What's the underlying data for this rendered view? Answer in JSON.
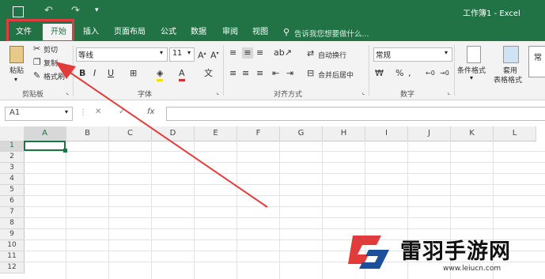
{
  "title_bar": {
    "title": "工作簿1 - Excel"
  },
  "tabs": [
    "文件",
    "开始",
    "插入",
    "页面布局",
    "公式",
    "数据",
    "审阅",
    "视图"
  ],
  "tell_me": "告诉我您想要做什么...",
  "clipboard": {
    "paste": "粘贴",
    "cut": "剪切",
    "copy": "复制",
    "painter": "格式刷",
    "label": "剪贴板"
  },
  "font": {
    "name": "等线",
    "size": "11",
    "label": "字体"
  },
  "alignment": {
    "wrap": "自动换行",
    "merge": "合并后居中",
    "label": "对齐方式"
  },
  "number": {
    "format": "常规",
    "label": "数字"
  },
  "styles": {
    "conditional": "条件格式",
    "table_l1": "套用",
    "table_l2": "表格格式",
    "normal": "常"
  },
  "formula_bar": {
    "name_box": "A1",
    "fx": "fx"
  },
  "columns": [
    "A",
    "B",
    "C",
    "D",
    "E",
    "F",
    "G",
    "H",
    "I",
    "J",
    "K",
    "L"
  ],
  "rows": [
    "1",
    "2",
    "3",
    "4",
    "5",
    "6",
    "7",
    "8",
    "9",
    "10",
    "11",
    "12"
  ],
  "watermark": {
    "text": "雷羽手游网",
    "url": "www.leiucn.com"
  },
  "colors": {
    "excel_green": "#217346",
    "highlight_red": "#e23b3b"
  }
}
